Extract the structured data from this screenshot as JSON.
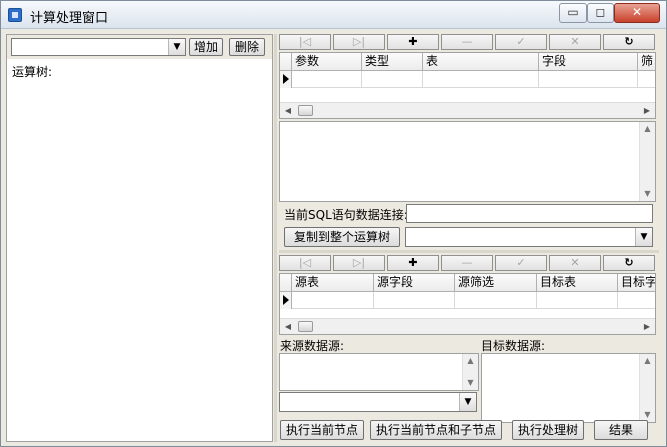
{
  "window": {
    "title": "计算处理窗口",
    "controls": {
      "minimize": "▭",
      "maximize": "◻",
      "close": "✕"
    }
  },
  "left": {
    "combo_value": "",
    "add_label": "增加",
    "delete_label": "删除",
    "tree_label": "运算树:"
  },
  "top_grid": {
    "nav": [
      "|◁",
      "▷|",
      "✚",
      "—",
      "✓",
      "✕",
      "↻"
    ],
    "columns": [
      "参数",
      "类型",
      "表",
      "字段",
      "筛"
    ]
  },
  "sql": {
    "connection_label": "当前SQL语句数据连接:",
    "connection_value": "",
    "copy_button": "复制到整个运算树",
    "copy_combo_value": ""
  },
  "bottom_grid": {
    "nav": [
      "|◁",
      "▷|",
      "✚",
      "—",
      "✓",
      "✕",
      "↻"
    ],
    "columns": [
      "源表",
      "源字段",
      "源筛选",
      "目标表",
      "目标字"
    ]
  },
  "datasources": {
    "source_label": "来源数据源:",
    "target_label": "目标数据源:",
    "source_combo_value": ""
  },
  "actions": {
    "exec_current": "执行当前节点",
    "exec_current_children": "执行当前节点和子节点",
    "exec_tree": "执行处理树",
    "result": "结果"
  }
}
